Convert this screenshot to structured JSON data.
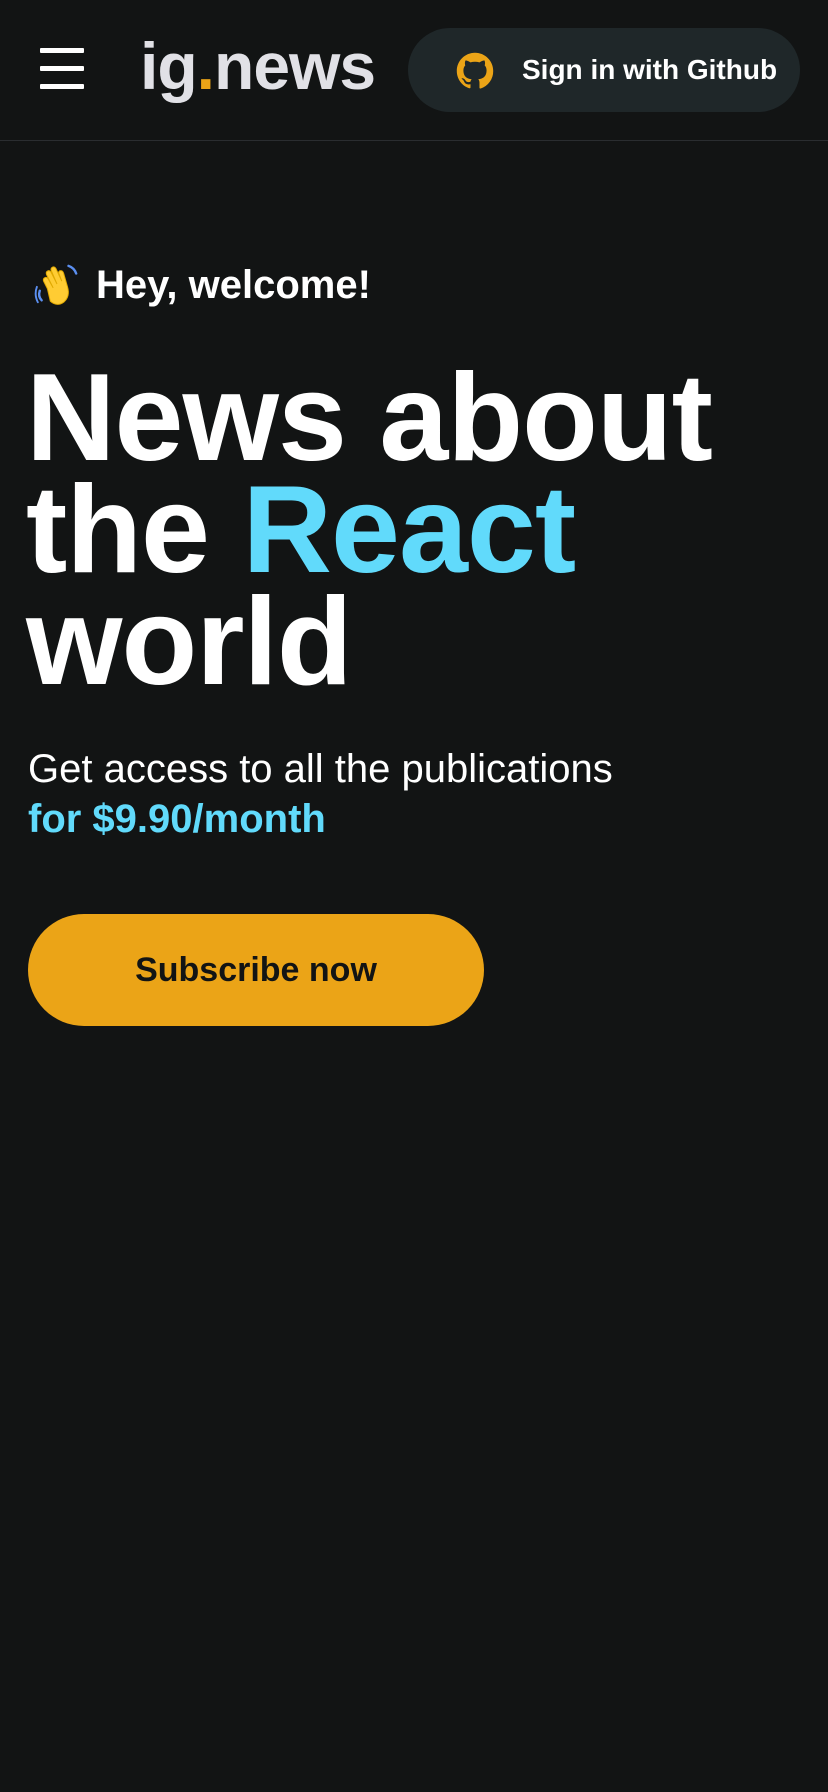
{
  "header": {
    "logo": {
      "prefix": "ig",
      "dot": ".",
      "suffix": "news"
    },
    "menu_icon": "hamburger-menu-icon",
    "signin": {
      "icon": "github-icon",
      "label": "Sign in with Github"
    }
  },
  "hero": {
    "welcome_icon": "waving-hand-icon",
    "welcome": "Hey, welcome!",
    "headline": {
      "line1": "News about",
      "line2_prefix": "the ",
      "line2_accent": "React",
      "line3": "world"
    },
    "subtitle": "Get access to all the publications",
    "price": "for $9.90/month",
    "cta_label": "Subscribe now"
  },
  "colors": {
    "background": "#121414",
    "header_button_bg": "#1f2729",
    "accent_yellow": "#eba417",
    "accent_cyan": "#61dafb",
    "text_primary": "#ffffff",
    "logo_text": "#e1e1e6"
  }
}
